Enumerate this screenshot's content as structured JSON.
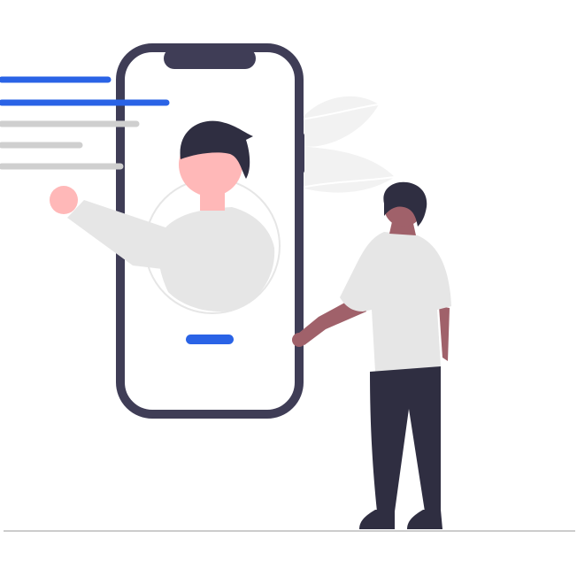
{
  "illustration": {
    "subject": "",
    "colors": {
      "accent": "#2a63e6",
      "placeholder_gray": "#cfcfcf",
      "dark": "#2f2e41",
      "skin_light": "#ffb8b8",
      "skin_dark": "#a0616a",
      "shirt": "#e6e6e6",
      "leaf": "#f2f2f2",
      "ground": "#cccccc",
      "background": "#ffffff"
    },
    "text_lines": [
      {
        "style": "accent"
      },
      {
        "style": "accent"
      },
      {
        "style": "placeholder"
      },
      {
        "style": "placeholder"
      },
      {
        "style": "placeholder"
      }
    ],
    "icons": [
      "phone-icon",
      "profile-avatar-icon",
      "person-icon",
      "leaf-icon"
    ]
  }
}
